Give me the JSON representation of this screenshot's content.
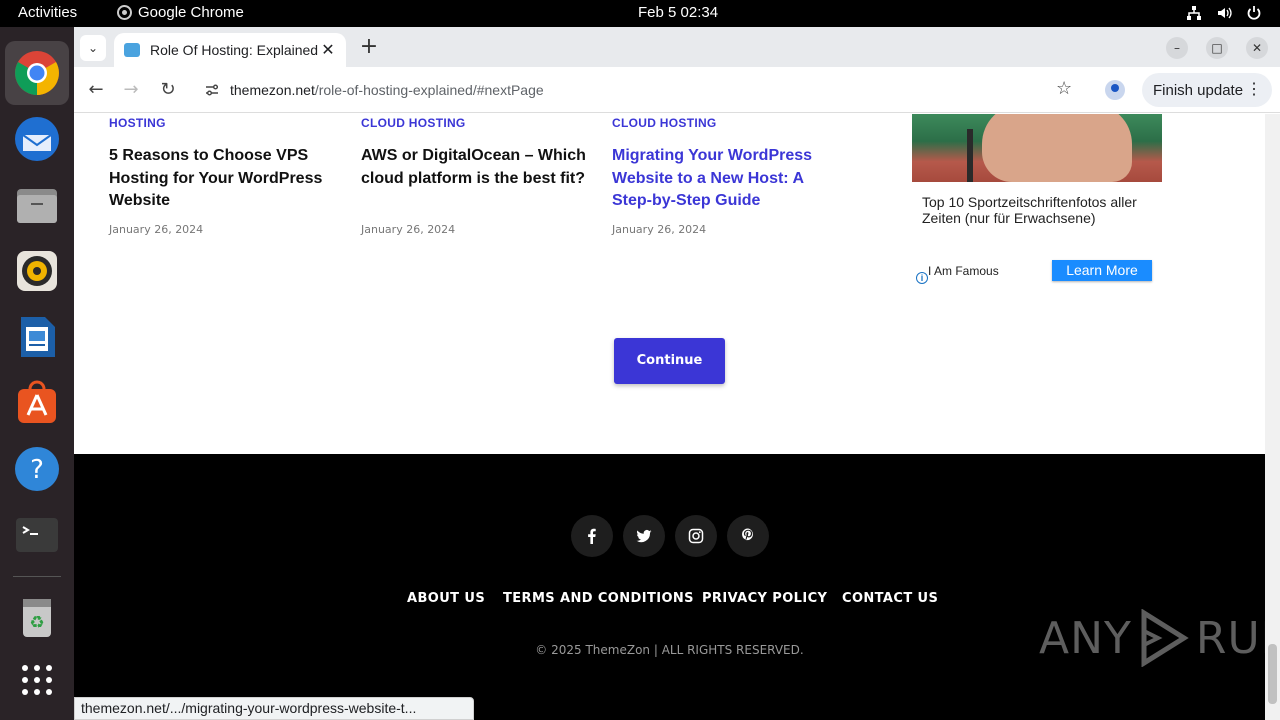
{
  "system": {
    "activities": "Activities",
    "app_name": "Google Chrome",
    "clock": "Feb 5  02:34"
  },
  "dock": {
    "items": [
      "chrome",
      "thunderbird",
      "files",
      "rhythmbox",
      "libreoffice-writer",
      "app-center",
      "help",
      "terminal",
      "trash",
      "app-grid"
    ]
  },
  "browser": {
    "tab_title": "Role Of Hosting: Explained",
    "url_host": "themezon.net",
    "url_path": "/role-of-hosting-explained/#nextPage",
    "update_label": "Finish update",
    "status_url": "themezon.net/.../migrating-your-wordpress-website-t..."
  },
  "posts": [
    {
      "category": "HOSTING",
      "title": "5 Reasons to Choose VPS Hosting for Your WordPress Website",
      "date": "January 26, 2024"
    },
    {
      "category": "CLOUD HOSTING",
      "title": "AWS or DigitalOcean – Which cloud platform is the best fit?",
      "date": "January 26, 2024"
    },
    {
      "category": "CLOUD HOSTING",
      "title": "Migrating Your WordPress Website to a New Host: A Step-by-Step Guide",
      "date": "January 26, 2024"
    }
  ],
  "ad": {
    "text": "Top 10 Sportzeitschriftenfotos aller Zeiten (nur für Erwachsene)",
    "source": "I Am Famous",
    "button": "Learn More",
    "info": "i"
  },
  "continue_label": "Continue",
  "footer": {
    "social": [
      "facebook",
      "twitter",
      "instagram",
      "pinterest"
    ],
    "nav": [
      "ABOUT US",
      "TERMS AND CONDITIONS",
      "PRIVACY POLICY",
      "CONTACT US"
    ],
    "copyright": "© 2025 ThemeZon | ALL RIGHTS RESERVED.",
    "watermark_left": "ANY",
    "watermark_right": "RUN"
  },
  "colors": {
    "accent": "#3b36d6",
    "footer_bg": "#000000",
    "ad_button": "#1a8cff"
  }
}
